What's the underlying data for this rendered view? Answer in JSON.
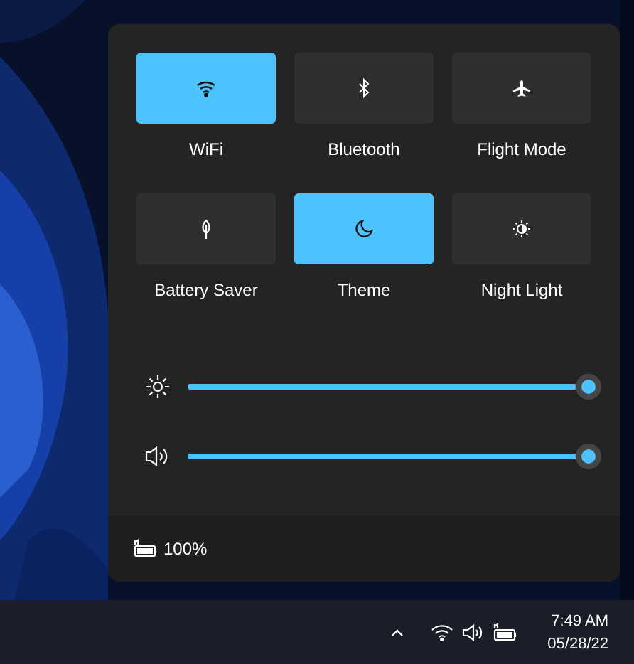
{
  "quick_settings": {
    "tiles": [
      {
        "kind": "wifi",
        "label": "WiFi",
        "selected": true
      },
      {
        "kind": "bluetooth",
        "label": "Bluetooth",
        "selected": false
      },
      {
        "kind": "flight",
        "label": "Flight Mode",
        "selected": false
      },
      {
        "kind": "leaf",
        "label": "Battery Saver",
        "selected": false
      },
      {
        "kind": "moon",
        "label": "Theme",
        "selected": true
      },
      {
        "kind": "nightlight",
        "label": "Night Light",
        "selected": false
      }
    ],
    "sliders": [
      {
        "kind": "brightness",
        "level": 1.0
      },
      {
        "kind": "volume",
        "level": 1.0
      }
    ],
    "battery": {
      "reading": "100%"
    }
  },
  "taskbar": {
    "time": "7:49 AM",
    "date": "05/28/22"
  }
}
